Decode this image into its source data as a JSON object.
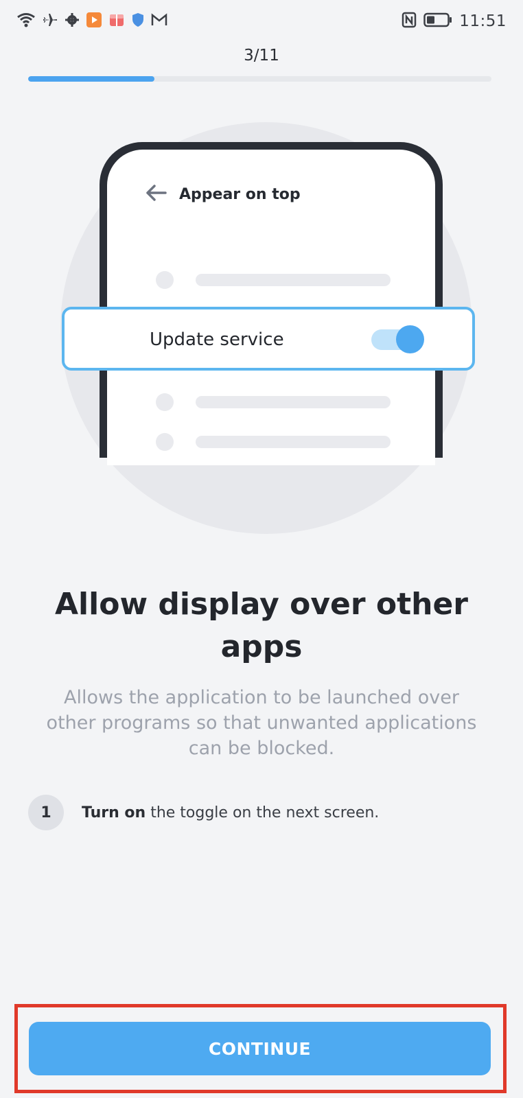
{
  "status_bar": {
    "left_icons": [
      "wifi-icon",
      "airplane-icon",
      "gear-icon",
      "video-app-icon",
      "gift-app-icon",
      "shield-icon",
      "mail-icon"
    ],
    "right_icons": [
      "nfc-icon",
      "battery-icon"
    ],
    "time": "11:51"
  },
  "progress": {
    "step_text": "3/11",
    "current": 3,
    "total": 11,
    "accent_color": "#4ba3ef"
  },
  "illustration": {
    "phone_title": "Appear on top",
    "back_icon": "back-arrow-icon",
    "toggle_label": "Update service",
    "toggle_on": true
  },
  "content": {
    "title": "Allow display over other apps",
    "description": "Allows the application to be launched over other programs so that unwanted applications can be blocked."
  },
  "steps": [
    {
      "number": "1",
      "bold": "Turn on",
      "text": " the toggle on the next screen."
    }
  ],
  "continue_button": {
    "label": "CONTINUE",
    "color": "#4eaaf1"
  }
}
